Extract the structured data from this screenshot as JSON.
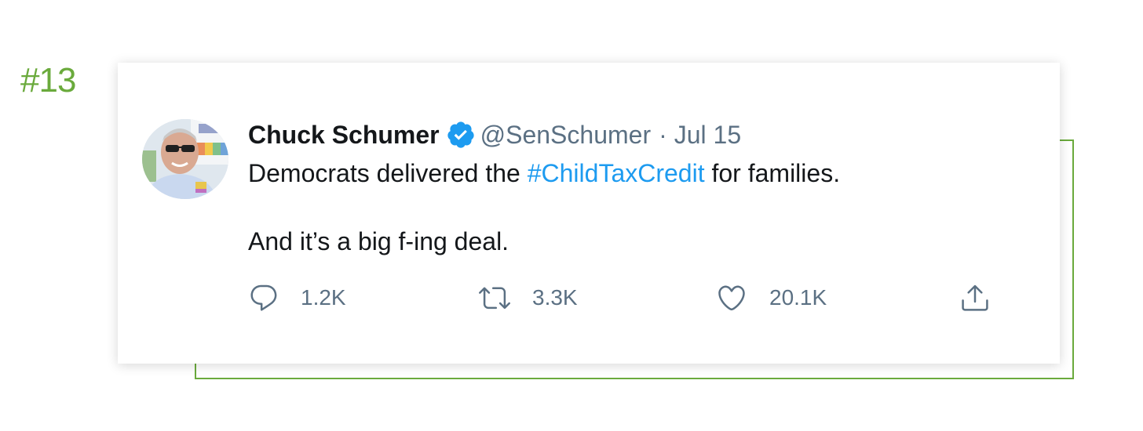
{
  "post_rank": "#13",
  "tweet": {
    "author": {
      "display_name": "Chuck Schumer",
      "handle": "@SenSchumer",
      "verified": true,
      "avatar_icon": "profile-photo"
    },
    "separator": "·",
    "date": "Jul 15",
    "text": {
      "line1_before": "Democrats delivered the ",
      "hashtag": "#ChildTaxCredit",
      "line1_after": " for families.",
      "line2": "And it’s a big f-ing deal."
    },
    "actions": {
      "reply": {
        "icon": "reply-icon",
        "count": "1.2K"
      },
      "retweet": {
        "icon": "retweet-icon",
        "count": "3.3K"
      },
      "like": {
        "icon": "heart-icon",
        "count": "20.1K"
      },
      "share": {
        "icon": "share-icon"
      }
    }
  },
  "colors": {
    "accent_green": "#6aaa3c",
    "hashtag_blue": "#1d9bf0",
    "verified_blue": "#1d9bf0",
    "secondary_text": "#5b7083",
    "primary_text": "#14171a"
  }
}
